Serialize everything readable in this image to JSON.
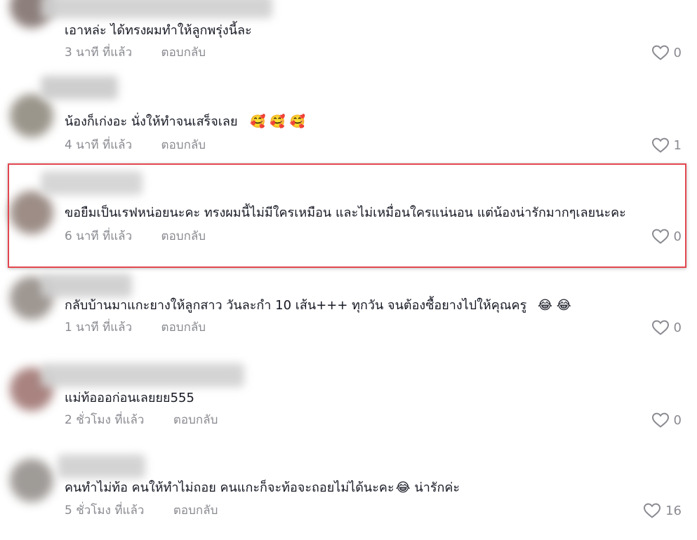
{
  "comments": [
    {
      "text": "เอาหล่ะ ได้ทรงผมทำให้ลูกพรุ่งนี้ละ",
      "emoji": "",
      "time": "3 นาที ที่แล้ว",
      "reply_label": "ตอบกลับ",
      "likes": "0"
    },
    {
      "text": "น้องก็เก่งอะ นั่งให้ทำจนเสร็จเลย",
      "emoji": "🥰 🥰 🥰",
      "time": "4 นาที ที่แล้ว",
      "reply_label": "ตอบกลับ",
      "likes": "1"
    },
    {
      "text": "ขอยืมเป็นเรฟหน่อยนะคะ ทรงผมนี้ไม่มีใครเหมือน และไม่เหมื่อนใครแน่นอน แต่น้องน่ารักมากๆเลยนะคะ",
      "emoji": "",
      "time": "6 นาที ที่แล้ว",
      "reply_label": "ตอบกลับ",
      "likes": "0"
    },
    {
      "text": "กลับบ้านมาแกะยางให้ลูกสาว วันละกำ 10 เส้น+++ ทุกวัน จนต้องซื้อยางไปให้คุณครู",
      "emoji": "😂 😂",
      "time": "1 นาที ที่แล้ว",
      "reply_label": "ตอบกลับ",
      "likes": "0"
    },
    {
      "text": "แม่ท้อออก่อนเลยยย555",
      "emoji": "",
      "time": "2 ชั่วโมง ที่แล้ว",
      "reply_label": "ตอบกลับ",
      "likes": "0"
    },
    {
      "text": "คนทำไม่ท้อ คนให้ทำไม่ถอย คนแกะก็จะท้อจะถอยไม่ได้นะคะ",
      "emoji": "😂",
      "text_after": "น่ารักค่ะ",
      "time": "5 ชั่วโมง ที่แล้ว",
      "reply_label": "ตอบกลับ",
      "likes": "16"
    }
  ],
  "colors": {
    "highlight_border": "#e3474f",
    "text": "#161823",
    "meta": "#8a8b91"
  },
  "icons": {
    "like": "heart-outline-icon"
  }
}
